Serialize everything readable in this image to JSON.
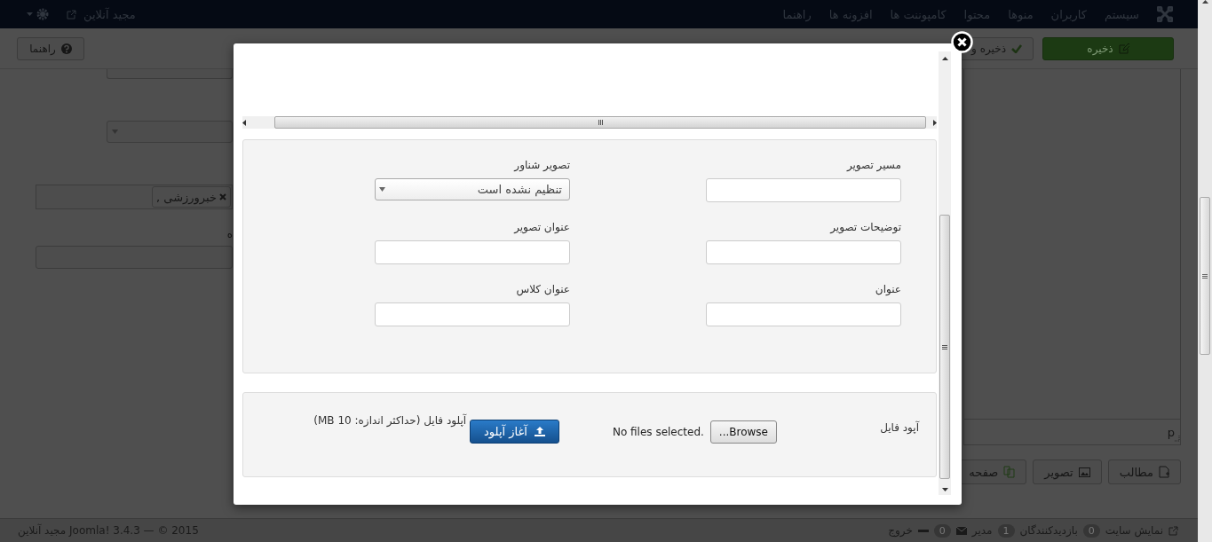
{
  "navbar": {
    "menu": [
      "سیستم",
      "کاربران",
      "منوها",
      "محتوا",
      "کامپوننت ها",
      "افزونه ها",
      "راهنما"
    ],
    "user": "مجید آنلاین"
  },
  "toolbar": {
    "buttons": [
      {
        "label": "ذخیره",
        "kind": "primary"
      },
      {
        "label": "ذخیره و",
        "kind": "check"
      }
    ],
    "help": "راهنما"
  },
  "background_form": {
    "tags": [
      "خبرورزشی ,"
    ],
    "label": "ه"
  },
  "editor": {
    "path": "p",
    "buttons": [
      {
        "label": "مطالب",
        "kind": "article"
      },
      {
        "label": "تصویر",
        "kind": "image"
      },
      {
        "label": "صفحه",
        "kind": "pagebreak"
      }
    ]
  },
  "modal": {
    "fields": [
      {
        "label": "مسیر تصویر",
        "kind": "text"
      },
      {
        "label": "تصویر شناور",
        "kind": "select",
        "value": "تنظیم نشده است"
      },
      {
        "label": "توضیحات تصویر",
        "kind": "text"
      },
      {
        "label": "عنوان تصویر",
        "kind": "text"
      },
      {
        "label": "عنوان",
        "kind": "text"
      },
      {
        "label": "عنوان کلاس",
        "kind": "text"
      }
    ],
    "upload": {
      "label": "آپود فایل",
      "browse": "...Browse",
      "file_status": "No files selected.",
      "start": "آغاز آپلود",
      "hint": "آپلود فایل (حداکثر اندازه: 10 MB)"
    }
  },
  "footer": {
    "items": [
      {
        "kind": "link",
        "label": "نمایش سایت"
      },
      {
        "kind": "count",
        "count": "0",
        "label": "بازدیدکنندگان"
      },
      {
        "kind": "count",
        "count": "1",
        "label": "مدیر"
      },
      {
        "kind": "mail",
        "count": "0"
      },
      {
        "kind": "logout",
        "label": "خروج"
      }
    ],
    "copyright": "مجید آنلاین Joomla! 3.4.3 — © 2015"
  }
}
